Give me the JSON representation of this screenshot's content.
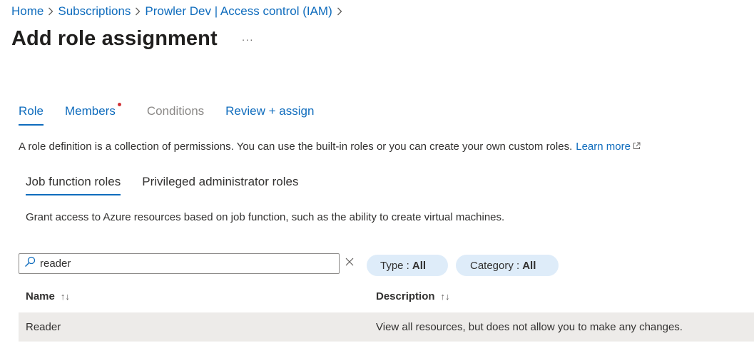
{
  "breadcrumb": [
    {
      "label": "Home"
    },
    {
      "label": "Subscriptions"
    },
    {
      "label": "Prowler Dev | Access control (IAM)"
    }
  ],
  "breadcrumb_separator": ">",
  "page_title": "Add role assignment",
  "more_label": "···",
  "tabs": [
    {
      "label": "Role",
      "state": "active"
    },
    {
      "label": "Members",
      "state": "required"
    },
    {
      "label": "Conditions",
      "state": "disabled"
    },
    {
      "label": "Review + assign",
      "state": "normal"
    }
  ],
  "description": {
    "text": "A role definition is a collection of permissions. You can use the built-in roles or you can create your own custom roles.",
    "learn_more": "Learn more"
  },
  "subtabs": [
    {
      "label": "Job function roles",
      "active": true
    },
    {
      "label": "Privileged administrator roles",
      "active": false
    }
  ],
  "grant_text": "Grant access to Azure resources based on job function, such as the ability to create virtual machines.",
  "search": {
    "value": "reader",
    "placeholder": ""
  },
  "filters": {
    "type": {
      "label": "Type :",
      "value": "All"
    },
    "category": {
      "label": "Category :",
      "value": "All"
    }
  },
  "table": {
    "columns": [
      "Name",
      "Description"
    ],
    "sort_glyph": "↑↓",
    "rows": [
      {
        "name": "Reader",
        "description": "View all resources, but does not allow you to make any changes."
      }
    ]
  },
  "colors": {
    "accent": "#0f6cbd",
    "required_dot": "#d13438",
    "pill_bg": "#deecf9",
    "selected_row": "#edebe9"
  }
}
